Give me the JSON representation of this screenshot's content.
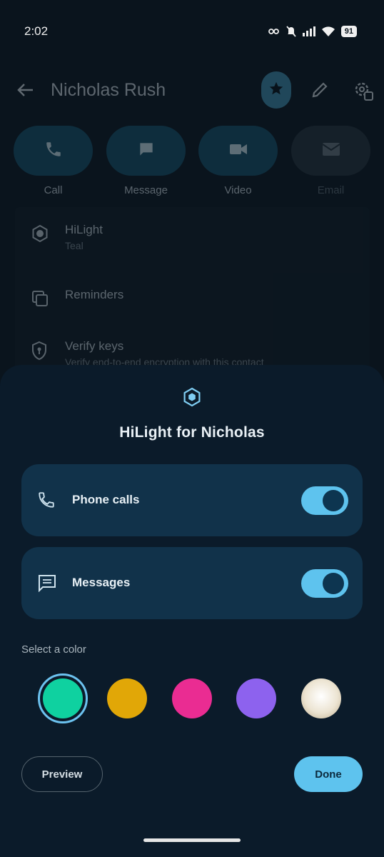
{
  "status_bar": {
    "time": "2:02",
    "battery": "91"
  },
  "contact": {
    "name": "Nicholas Rush",
    "actions": [
      {
        "label": "Call",
        "icon": "phone-icon",
        "enabled": true
      },
      {
        "label": "Message",
        "icon": "chat-bubble-icon",
        "enabled": true
      },
      {
        "label": "Video",
        "icon": "videocam-icon",
        "enabled": true
      },
      {
        "label": "Email",
        "icon": "mail-icon",
        "enabled": false
      }
    ],
    "list": [
      {
        "title": "HiLight",
        "subtitle": "Teal",
        "icon": "hilight-icon"
      },
      {
        "title": "Reminders",
        "subtitle": "",
        "icon": "reminders-icon"
      },
      {
        "title": "Verify keys",
        "subtitle": "Verify end-to-end encryption with this contact",
        "icon": "shield-icon"
      }
    ]
  },
  "sheet": {
    "title": "HiLight for Nicholas",
    "options": [
      {
        "label": "Phone calls",
        "icon": "phone-icon",
        "enabled": true
      },
      {
        "label": "Messages",
        "icon": "message-icon",
        "enabled": true
      }
    ],
    "color_label": "Select a color",
    "colors": [
      {
        "name": "teal",
        "hex": "#0fd1a0",
        "selected": true
      },
      {
        "name": "yellow",
        "hex": "#e1a707",
        "selected": false
      },
      {
        "name": "pink",
        "hex": "#ea2c92",
        "selected": false
      },
      {
        "name": "purple",
        "hex": "#8d62ee",
        "selected": false
      },
      {
        "name": "pearl",
        "hex": "#ece4d2",
        "selected": false
      }
    ],
    "preview_label": "Preview",
    "done_label": "Done"
  },
  "colors": {
    "accent": "#5ec3ee",
    "sheet_bg": "#0b1b2a",
    "card_bg": "#11324a"
  }
}
